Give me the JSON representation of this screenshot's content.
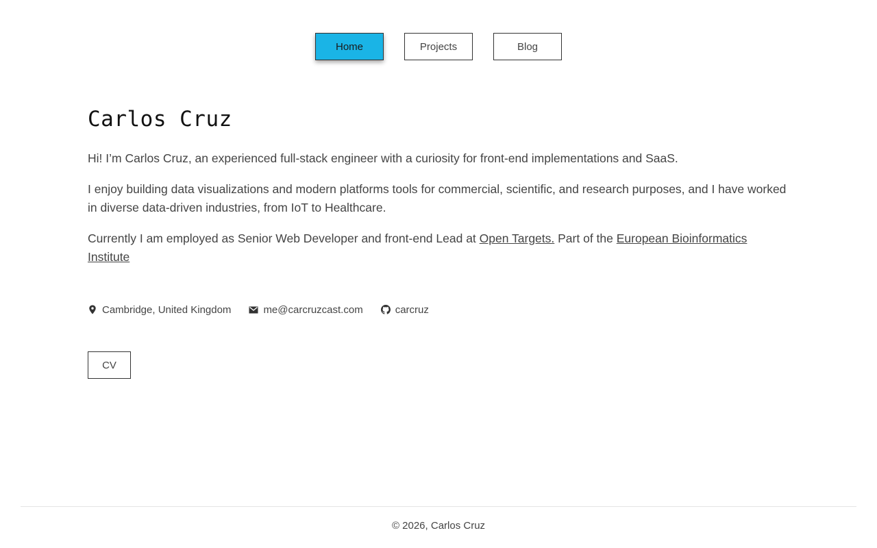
{
  "nav": {
    "items": [
      {
        "label": "Home",
        "active": true
      },
      {
        "label": "Projects",
        "active": false
      },
      {
        "label": "Blog",
        "active": false
      }
    ]
  },
  "colors": {
    "accent": "#1ab4e6"
  },
  "profile": {
    "name": "Carlos Cruz",
    "intro_1": "Hi! I’m Carlos Cruz, an experienced full-stack engineer with a curiosity for front-end implementations and SaaS.",
    "intro_2": "I enjoy building data visualizations and modern platforms tools for commercial, scientific, and research purposes, and I have worked in diverse data-driven industries, from IoT to Healthcare.",
    "intro_3": {
      "prefix": "Currently I am employed as Senior Web Developer and front-end Lead at ",
      "link_1": "Open Targets.",
      "middle": " Part of the ",
      "link_2": "European Bioinformatics Institute"
    }
  },
  "contacts": {
    "location": {
      "icon": "location-pin-icon",
      "text": "Cambridge, United Kingdom"
    },
    "email": {
      "icon": "mail-icon",
      "text": "me@carcruzcast.com"
    },
    "github": {
      "icon": "github-icon",
      "text": "carcruz"
    }
  },
  "cv_button": {
    "label": "CV"
  },
  "footer": {
    "text": "© 2026, Carlos Cruz"
  }
}
